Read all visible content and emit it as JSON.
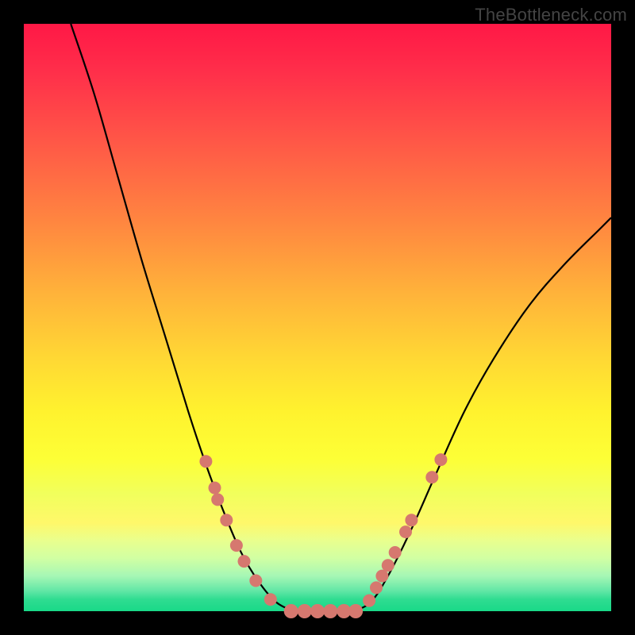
{
  "attribution": "TheBottleneck.com",
  "colors": {
    "background": "#000000",
    "curve": "#000000",
    "dots": "#d6786f"
  },
  "chart_data": {
    "type": "line",
    "title": "",
    "xlabel": "",
    "ylabel": "",
    "series": [
      {
        "name": "left-arm",
        "points": [
          {
            "x": 0.08,
            "y": 1.0
          },
          {
            "x": 0.12,
            "y": 0.88
          },
          {
            "x": 0.16,
            "y": 0.74
          },
          {
            "x": 0.2,
            "y": 0.6
          },
          {
            "x": 0.24,
            "y": 0.47
          },
          {
            "x": 0.28,
            "y": 0.34
          },
          {
            "x": 0.31,
            "y": 0.25
          },
          {
            "x": 0.34,
            "y": 0.17
          },
          {
            "x": 0.37,
            "y": 0.1
          },
          {
            "x": 0.4,
            "y": 0.05
          },
          {
            "x": 0.43,
            "y": 0.015
          },
          {
            "x": 0.46,
            "y": 0.0
          }
        ]
      },
      {
        "name": "flat-bottom",
        "points": [
          {
            "x": 0.46,
            "y": 0.0
          },
          {
            "x": 0.56,
            "y": 0.0
          }
        ]
      },
      {
        "name": "right-arm",
        "points": [
          {
            "x": 0.56,
            "y": 0.0
          },
          {
            "x": 0.59,
            "y": 0.015
          },
          {
            "x": 0.62,
            "y": 0.06
          },
          {
            "x": 0.66,
            "y": 0.14
          },
          {
            "x": 0.7,
            "y": 0.23
          },
          {
            "x": 0.75,
            "y": 0.34
          },
          {
            "x": 0.8,
            "y": 0.43
          },
          {
            "x": 0.86,
            "y": 0.52
          },
          {
            "x": 0.92,
            "y": 0.59
          },
          {
            "x": 0.98,
            "y": 0.65
          },
          {
            "x": 1.0,
            "y": 0.67
          }
        ]
      }
    ],
    "dots_left": [
      {
        "x": 0.31,
        "y": 0.255,
        "r": 8
      },
      {
        "x": 0.325,
        "y": 0.21,
        "r": 8
      },
      {
        "x": 0.33,
        "y": 0.19,
        "r": 8
      },
      {
        "x": 0.345,
        "y": 0.155,
        "r": 8
      },
      {
        "x": 0.362,
        "y": 0.112,
        "r": 8
      },
      {
        "x": 0.375,
        "y": 0.085,
        "r": 8
      },
      {
        "x": 0.395,
        "y": 0.052,
        "r": 8
      },
      {
        "x": 0.42,
        "y": 0.02,
        "r": 8
      }
    ],
    "dots_bottom": [
      {
        "x": 0.455,
        "y": 0.0,
        "r": 9
      },
      {
        "x": 0.478,
        "y": 0.0,
        "r": 9
      },
      {
        "x": 0.5,
        "y": 0.0,
        "r": 9
      },
      {
        "x": 0.522,
        "y": 0.0,
        "r": 9
      },
      {
        "x": 0.545,
        "y": 0.0,
        "r": 9
      },
      {
        "x": 0.565,
        "y": 0.0,
        "r": 9
      }
    ],
    "dots_right": [
      {
        "x": 0.588,
        "y": 0.018,
        "r": 8
      },
      {
        "x": 0.6,
        "y": 0.04,
        "r": 8
      },
      {
        "x": 0.61,
        "y": 0.06,
        "r": 8
      },
      {
        "x": 0.62,
        "y": 0.078,
        "r": 8
      },
      {
        "x": 0.632,
        "y": 0.1,
        "r": 8
      },
      {
        "x": 0.65,
        "y": 0.135,
        "r": 8
      },
      {
        "x": 0.66,
        "y": 0.155,
        "r": 8
      },
      {
        "x": 0.695,
        "y": 0.228,
        "r": 8
      },
      {
        "x": 0.71,
        "y": 0.258,
        "r": 8
      }
    ],
    "xlim": [
      0,
      1
    ],
    "ylim": [
      0,
      1
    ]
  }
}
